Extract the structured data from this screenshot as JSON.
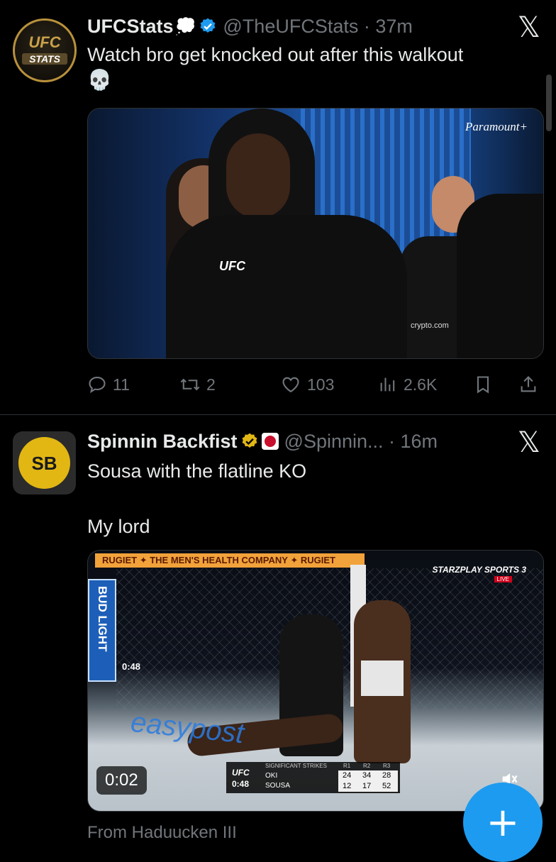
{
  "tweets": [
    {
      "name": "UFCStats",
      "name_emoji": "💭",
      "handle": "@TheUFCStats",
      "time": "37m",
      "text_line1": "Watch bro get knocked out after this walkout",
      "text_emoji": "💀",
      "avatar_text_top": "UFC",
      "avatar_text_bottom": "STATS",
      "media_labels": {
        "brand": "Paramount+",
        "jacket": "UFC",
        "sponsor": "crypto.com"
      },
      "actions": {
        "replies": "11",
        "reposts": "2",
        "likes": "103",
        "views": "2.6K"
      }
    },
    {
      "name": "Spinnin Backfist",
      "handle": "@Spinnin...",
      "time": "16m",
      "text_line1": "Sousa with the flatline KO",
      "text_line2": "My lord",
      "avatar_text": "SB",
      "media_labels": {
        "banner": "RUGIET ✦ THE MEN'S HEALTH COMPANY ✦ RUGIET",
        "side": "BUD LIGHT",
        "broadcaster": "STARZPLAY SPORTS 3",
        "live": "LIVE",
        "clock": "0:48",
        "easypost": "easypost",
        "score_title": "SIGNIFICANT STRIKES",
        "rounds": [
          "R1",
          "R2",
          "R3"
        ],
        "ufc_logo": "UFC",
        "ufc_time": "0:48",
        "fighter1": "OKI",
        "fighter2": "SOUSA",
        "f1_scores": [
          "24",
          "34",
          "28"
        ],
        "f2_scores": [
          "12",
          "17",
          "52"
        ]
      },
      "video_time": "0:02",
      "attribution": "From Haduucken III"
    }
  ],
  "fab_label": "+",
  "icons": [
    "reply-icon",
    "repost-icon",
    "like-icon",
    "views-icon",
    "bookmark-icon",
    "share-icon",
    "x-logo-icon",
    "verified-icon",
    "mute-icon"
  ],
  "colors": {
    "accent": "#1d9bf0",
    "muted": "#71767b",
    "gold": "#e2b714"
  }
}
